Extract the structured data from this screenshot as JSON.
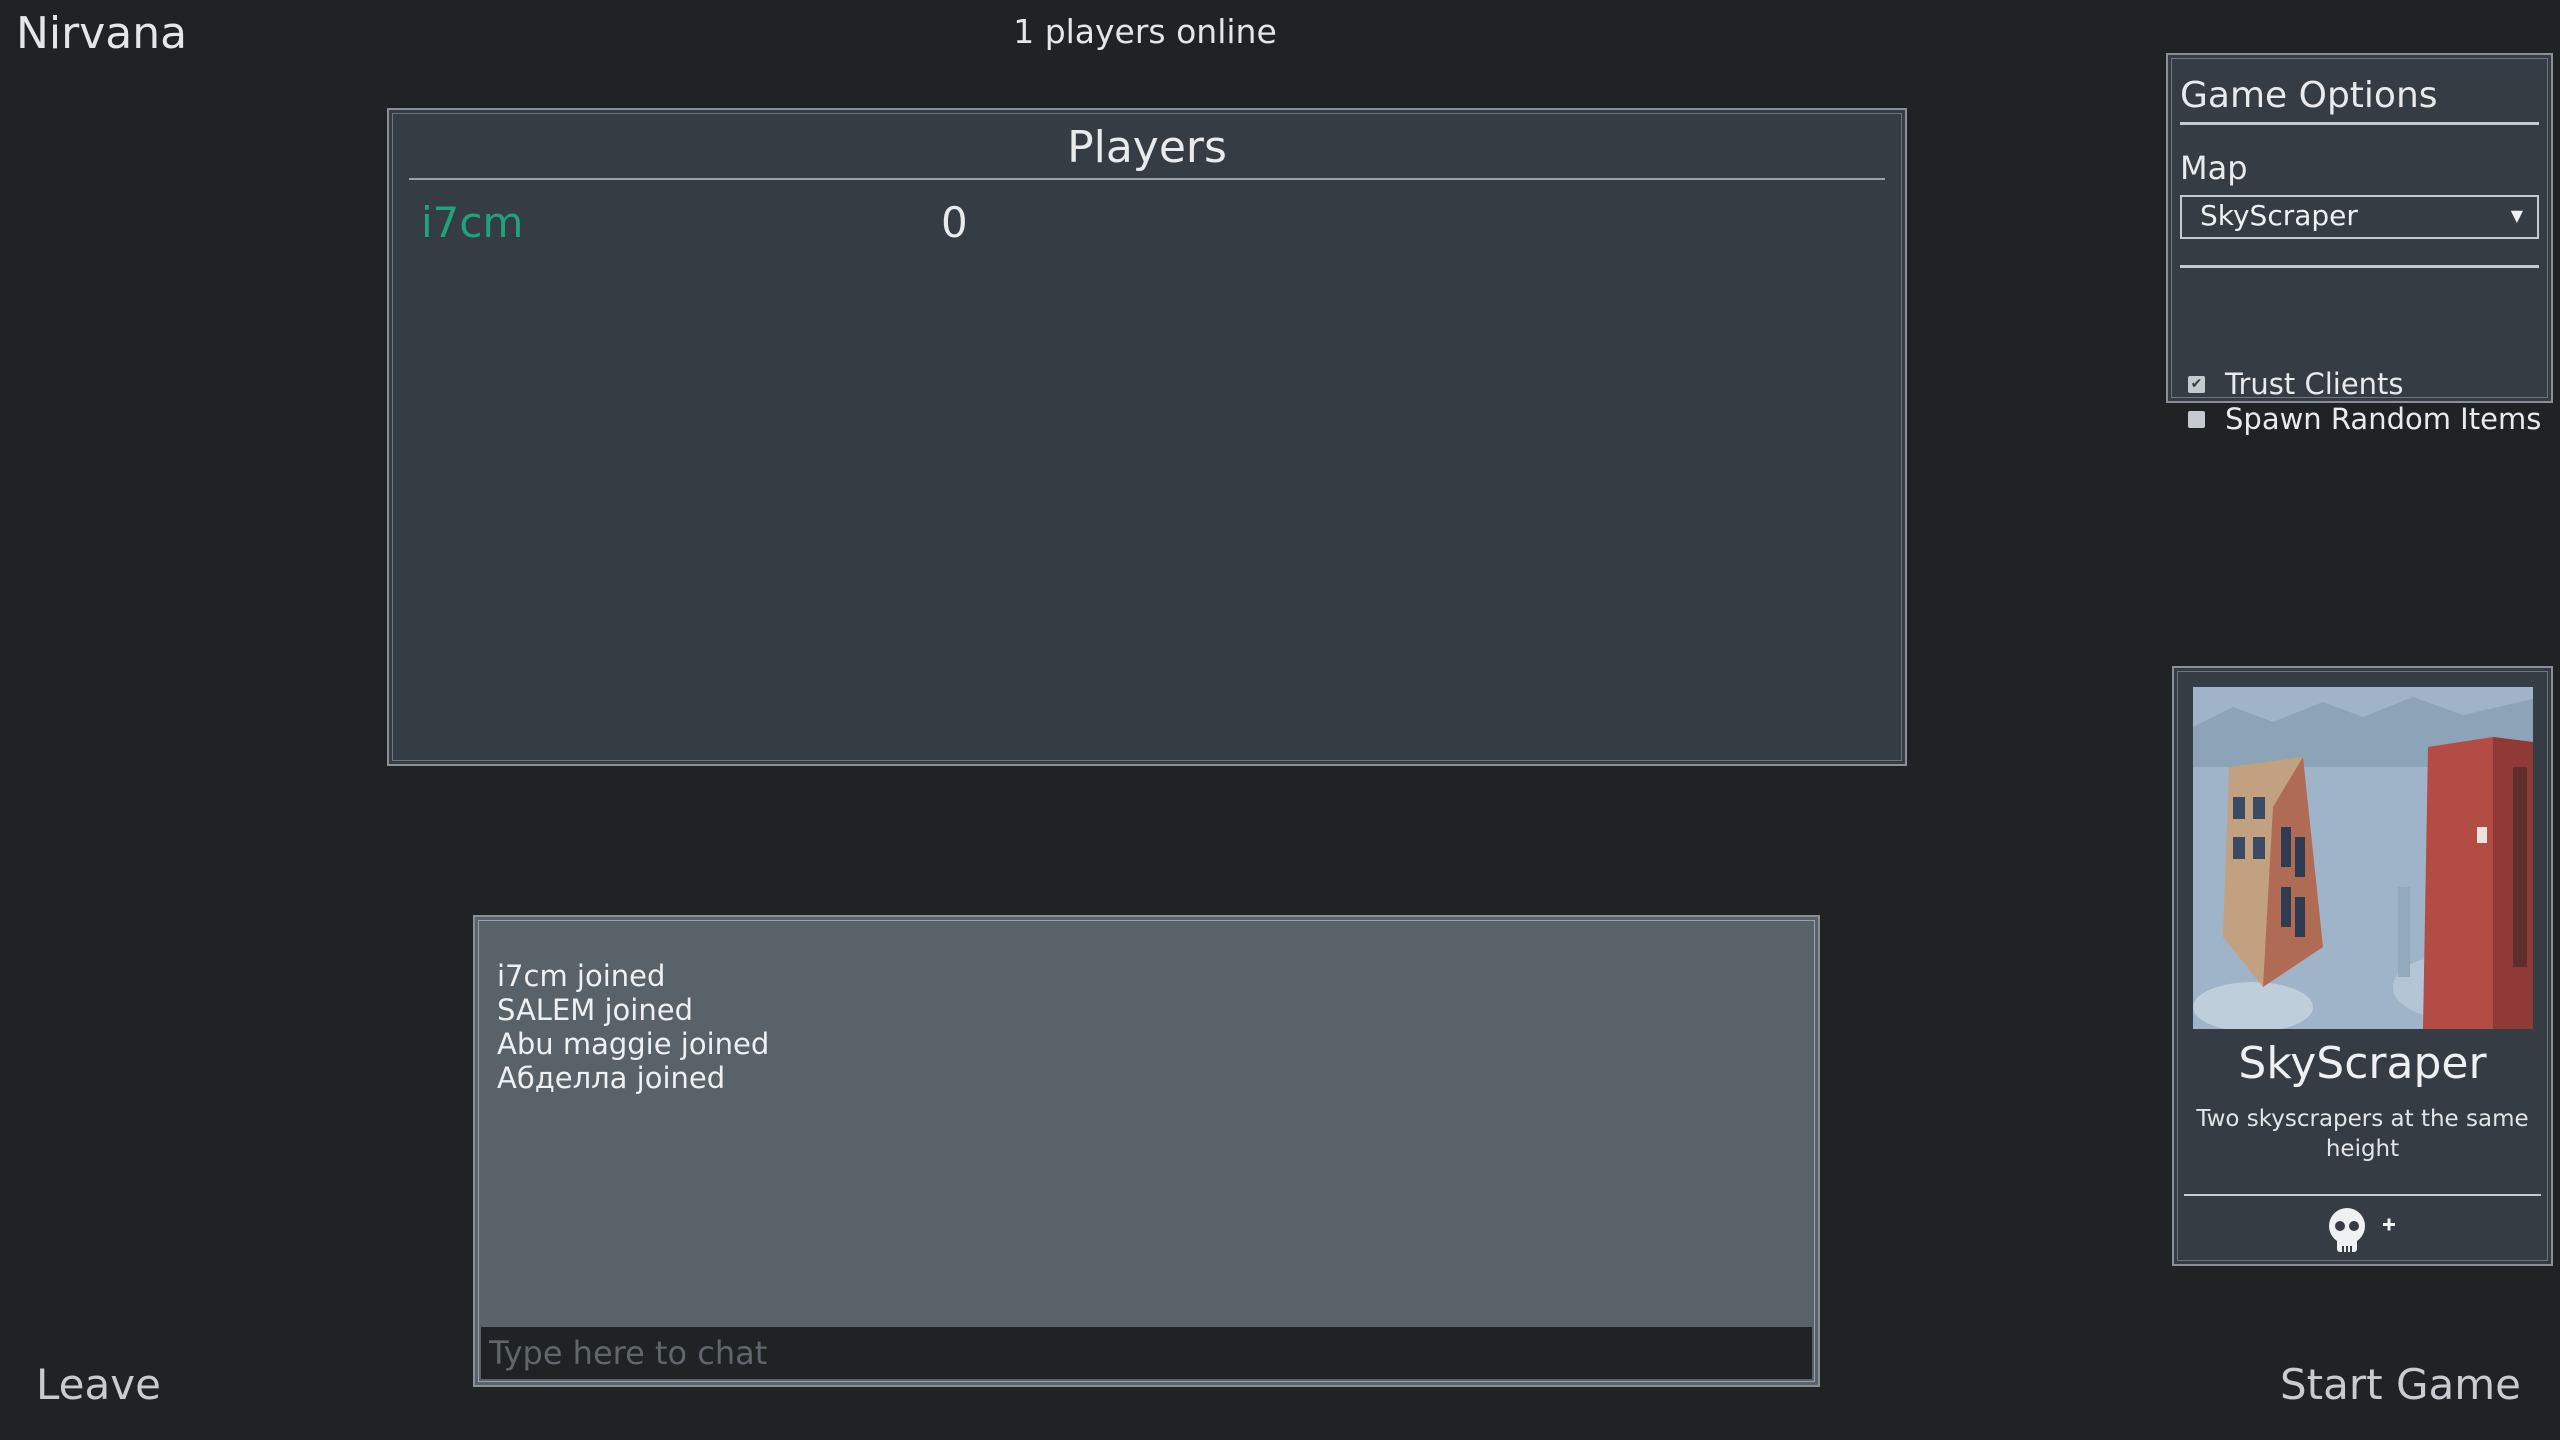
{
  "header": {
    "game_title": "Nirvana",
    "online_count": "1 players online"
  },
  "players_panel": {
    "heading": "Players",
    "players": [
      {
        "name": "i7cm",
        "score": "0",
        "name_color": "#1fa37a"
      }
    ]
  },
  "chat": {
    "messages": [
      "i7cm joined",
      "SALEM joined",
      "Abu maggie joined",
      "Абделла joined"
    ],
    "input_placeholder": "Type here to chat"
  },
  "game_options": {
    "title": "Game Options",
    "map_label": "Map",
    "map_selected": "SkyScraper",
    "options": [
      {
        "label": "Trust Clients",
        "checked": true
      },
      {
        "label": "Spawn Random Items",
        "checked": false
      }
    ]
  },
  "map_card": {
    "name": "SkyScraper",
    "description": "Two skyscrapers at the same height",
    "icons": [
      "skull-icon",
      "plus-icon"
    ]
  },
  "footer": {
    "leave_label": "Leave",
    "start_label": "Start Game"
  },
  "colors": {
    "background": "#1f2324",
    "panel": "#363c43",
    "chat_panel": "#5a6269",
    "player_name": "#1fa37a"
  }
}
